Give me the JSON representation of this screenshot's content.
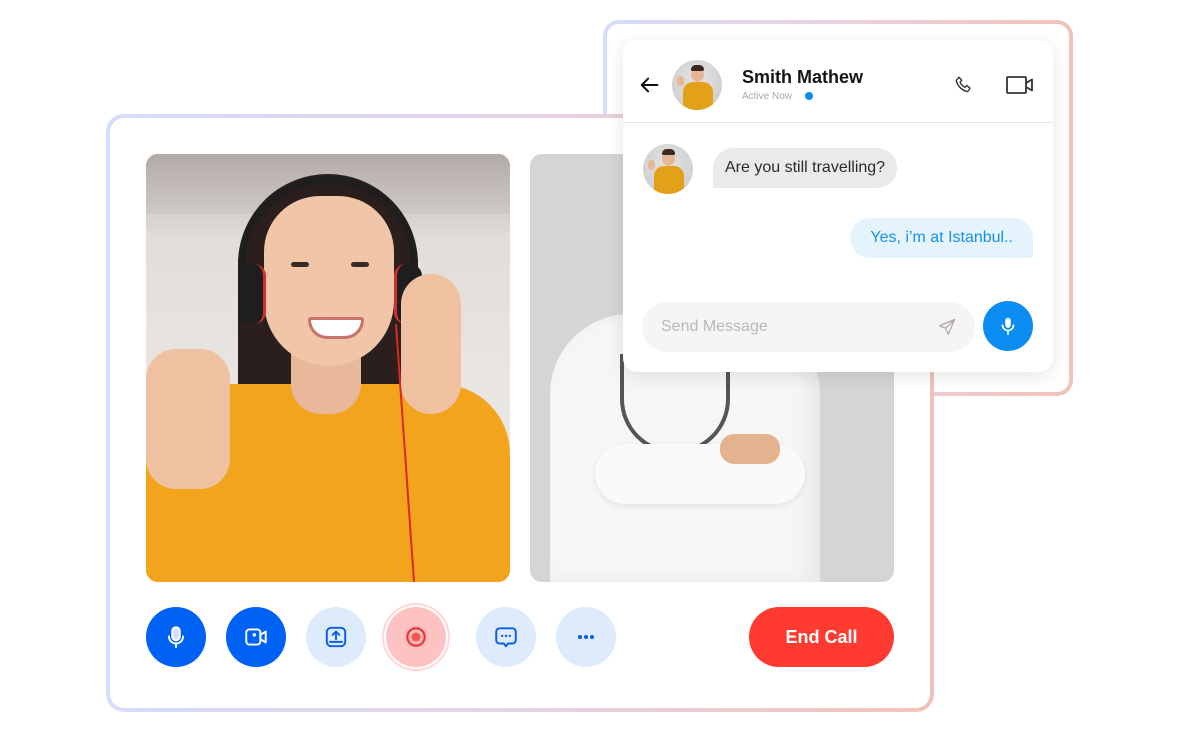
{
  "call": {
    "participants": [
      {
        "label": "participant-woman-headphones"
      },
      {
        "label": "participant-doctor"
      }
    ],
    "controls": [
      {
        "id": "mic",
        "icon": "microphone-icon",
        "active": true
      },
      {
        "id": "video",
        "icon": "video-camera-icon",
        "active": true
      },
      {
        "id": "share",
        "icon": "share-screen-icon",
        "active": false
      },
      {
        "id": "record",
        "icon": "record-icon",
        "active": true
      },
      {
        "id": "chat",
        "icon": "chat-bubble-icon",
        "active": false
      },
      {
        "id": "more",
        "icon": "more-options-icon",
        "active": false
      }
    ],
    "end_call_label": "End Call"
  },
  "chat": {
    "contact_name": "Smith Mathew",
    "status": "Active Now",
    "messages": [
      {
        "direction": "incoming",
        "text": "Are you still travelling?"
      },
      {
        "direction": "outgoing",
        "text": "Yes, i’m at Istanbul.."
      }
    ],
    "input": {
      "placeholder": "Send Message",
      "value": ""
    }
  },
  "colors": {
    "primary_blue": "#0062f5",
    "chat_blue": "#0a8cf0",
    "end_call_red": "#ff3a30",
    "record_pink": "#ffc2c2",
    "light_blue": "#deebfd"
  }
}
